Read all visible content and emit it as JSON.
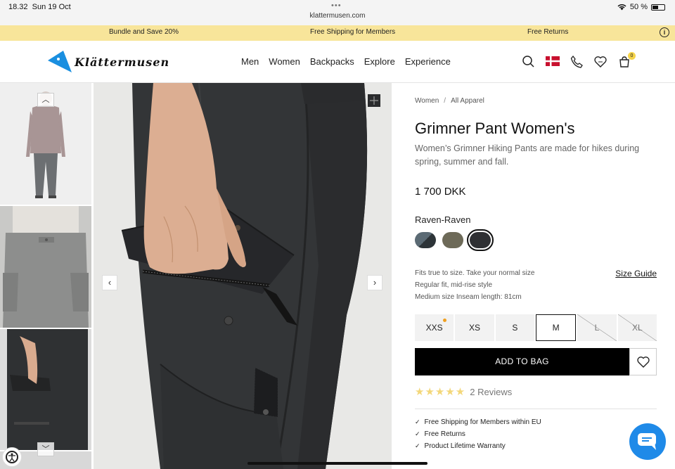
{
  "status_bar": {
    "time": "18.32",
    "date": "Sun 19 Oct",
    "url": "klattermusen.com",
    "battery": "50 %"
  },
  "promo": {
    "left": "Bundle and Save 20%",
    "center": "Free Shipping for Members",
    "right": "Free Returns",
    "info_icon": "info-icon"
  },
  "header": {
    "logo_text": "Klättermusen",
    "nav": [
      "Men",
      "Women",
      "Backpacks",
      "Explore",
      "Experience"
    ],
    "cart_count": "0",
    "icons": [
      "search-icon",
      "denmark-flag-icon",
      "phone-icon",
      "heart-icon",
      "bag-icon"
    ]
  },
  "product": {
    "breadcrumb": [
      "Women",
      "All Apparel"
    ],
    "title": "Grimner Pant Women's",
    "description": "Women’s Grimner Hiking Pants are made for hikes during spring, summer and fall.",
    "price": "1 700 DKK",
    "color_name": "Raven-Raven",
    "fit_lines": [
      "Fits true to size. Take your normal size",
      "Regular fit, mid-rise style",
      "Medium size Inseam length: 81cm"
    ],
    "size_guide": "Size Guide",
    "sizes": [
      "XXS",
      "XS",
      "S",
      "M",
      "L",
      "XL"
    ],
    "selected_size": "M",
    "add_to_bag": "ADD TO BAG",
    "stars": "★★★★★",
    "reviews": "2 Reviews",
    "perks": [
      "Free Shipping for Members within EU",
      "Free Returns",
      "Product Lifetime Warranty"
    ]
  },
  "colors": {
    "promo_bg": "#f8e59a",
    "accent_blue": "#1f8ae8",
    "logo_blue": "#1a8fe0"
  }
}
